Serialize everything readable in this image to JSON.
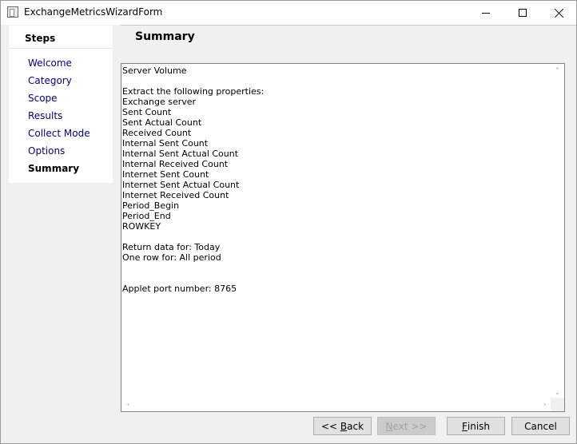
{
  "window": {
    "title": "ExchangeMetricsWizardForm"
  },
  "steps": {
    "header": "Steps",
    "items": [
      {
        "label": "Welcome",
        "active": false
      },
      {
        "label": "Category",
        "active": false
      },
      {
        "label": "Scope",
        "active": false
      },
      {
        "label": "Results",
        "active": false
      },
      {
        "label": "Collect Mode",
        "active": false
      },
      {
        "label": "Options",
        "active": false
      },
      {
        "label": "Summary",
        "active": true
      }
    ]
  },
  "page": {
    "heading": "Summary"
  },
  "summary": {
    "lines": [
      "Server Volume",
      "",
      "Extract the following properties:",
      "Exchange server",
      "Sent Count",
      "Sent Actual Count",
      "Received Count",
      "Internal Sent Count",
      "Internal Sent Actual Count",
      "Internal Received Count",
      "Internet Sent Count",
      "Internet Sent Actual Count",
      "Internet Received Count",
      "Period_Begin",
      "Period_End",
      "ROWKEY",
      "",
      "Return data for: Today",
      "One row for: All period",
      "",
      "",
      "Applet port number: 8765"
    ]
  },
  "buttons": {
    "back_pre": "<< ",
    "back_mn": "B",
    "back_post": "ack",
    "next_mn": "N",
    "next_post": "ext >>",
    "finish_mn": "F",
    "finish_post": "inish",
    "cancel": "Cancel"
  }
}
